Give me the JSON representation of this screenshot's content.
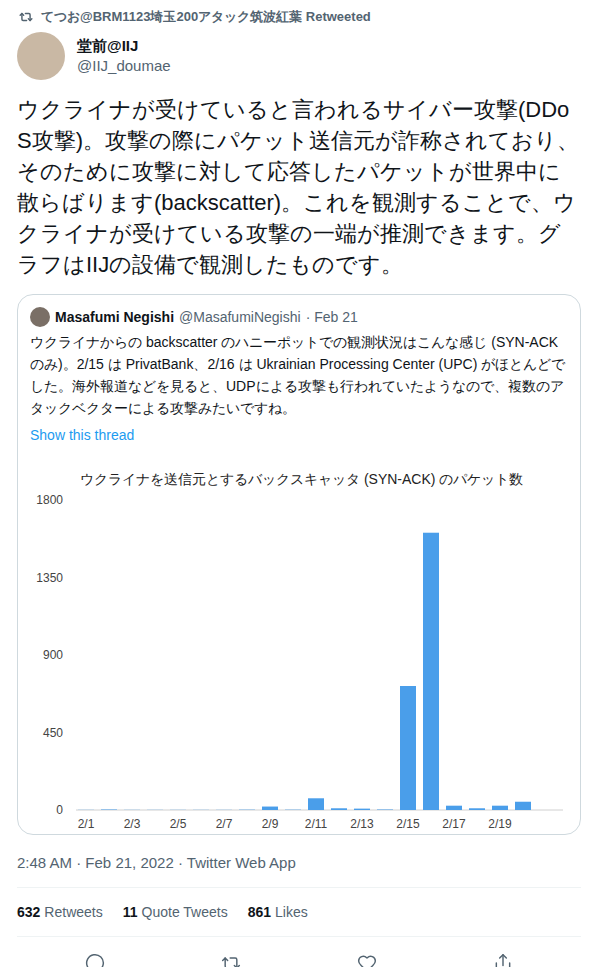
{
  "retweet_banner": {
    "text": "てつお@BRM1123埼玉200アタック筑波紅葉 Retweeted"
  },
  "tweet": {
    "author": {
      "name": "堂前@IIJ",
      "handle": "@IIJ_doumae"
    },
    "text": "ウクライナが受けていると言われるサイバー攻撃(DDoS攻撃)。攻撃の際にパケット送信元が詐称されており、そのために攻撃に対して応答したパケットが世界中に散らばります(backscatter)。これを観測することで、ウクライナが受けている攻撃の一端が推測できます。グラフはIIJの設備で観測したものです。",
    "timestamp": "2:48 AM · Feb 21, 2022 · Twitter Web App"
  },
  "quote": {
    "author": {
      "name": "Masafumi Negishi",
      "handle": "@MasafumiNegishi",
      "date": "· Feb 21"
    },
    "text": "ウクライナからの backscatter のハニーポットでの観測状況はこんな感じ (SYN-ACKのみ)。2/15 は PrivatBank、2/16 は Ukrainian Processing Center (UPC) がほとんどでした。海外報道などを見ると、UDPによる攻撃も行われていたようなので、複数のアタックベクターによる攻撃みたいですね。",
    "show_thread": "Show this thread",
    "chart": {
      "title": "ウクライナを送信元とするバックスキャッタ (SYN-ACK) のパケット数",
      "y_ticks": [
        "1800",
        "1350",
        "900",
        "450",
        "0"
      ],
      "x_labels": [
        "2/1",
        "2/3",
        "2/5",
        "2/7",
        "2/9",
        "2/11",
        "2/13",
        "2/15",
        "2/17",
        "2/19"
      ],
      "series": [
        {
          "name": "SYN-ACK",
          "values": [
            1,
            3,
            1,
            1,
            1,
            1,
            1,
            2,
            20,
            2,
            68,
            10,
            8,
            3,
            720,
            1610,
            25,
            10,
            25,
            48
          ]
        }
      ]
    }
  },
  "stats": [
    {
      "count": "632",
      "label": "Retweets"
    },
    {
      "count": "11",
      "label": "Quote Tweets"
    },
    {
      "count": "861",
      "label": "Likes"
    }
  ]
}
